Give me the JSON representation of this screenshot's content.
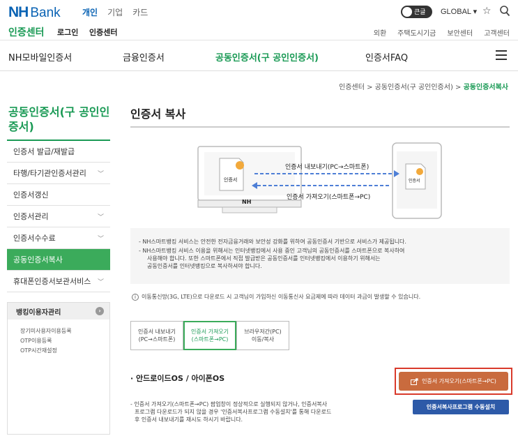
{
  "header": {
    "logo_nh": "NH",
    "logo_bank": "Bank",
    "nav": [
      "개인",
      "기업",
      "카드"
    ],
    "toggle_label": "큰글",
    "global_label": "GLOBAL ▾"
  },
  "certbar": {
    "title": "인증센터",
    "links": [
      "로그인",
      "인증센터"
    ],
    "utility": [
      "외환",
      "주택도시기금",
      "보안센터",
      "고객센터"
    ]
  },
  "mainnav": {
    "tabs": [
      "NH모바일인증서",
      "금융인증서",
      "공동인증서(구 공인인증서)",
      "인증서FAQ"
    ]
  },
  "breadcrumb": {
    "path": "인증센터 > 공동인증서(구 공인인증서) > ",
    "current": "공동인증서복사"
  },
  "sidebar": {
    "title": "공동인증서(구 공인인 증서)",
    "items": [
      {
        "label": "인증서 발급/재발급",
        "chevron": false
      },
      {
        "label": "타행/타기관인증서관리",
        "chevron": true
      },
      {
        "label": "인증서갱신",
        "chevron": false
      },
      {
        "label": "인증서관리",
        "chevron": true
      },
      {
        "label": "인증서수수료",
        "chevron": true
      },
      {
        "label": "공동인증서복사",
        "chevron": false
      },
      {
        "label": "휴대폰인증서보관서비스",
        "chevron": true
      }
    ],
    "box_title": "뱅킹이용자관리",
    "box_icon": "›",
    "box_links": [
      "장기미사용자이용등록",
      "OTP이용등록",
      "OTP시간재설정"
    ]
  },
  "content": {
    "title": "인증서 복사",
    "illus_export": "인증서 내보내기(PC→스마트폰)",
    "illus_import": "인증서 가져오기(스마트폰→PC)",
    "badge_pc": "인증서",
    "badge_phone": "인증서",
    "nh_mark": "NH",
    "notice": [
      "- NH스마트뱅킹 서비스는 안전한 전자금융거래와 보안성 강화를 위하여 공동인증서 기반으로 서비스가 제공됩니다.",
      "- NH스마트뱅킹 서비스 이용을 위해서는 인터넷뱅킹에서 사용 중인 고객님의 공동인증서를 스마트폰으로 복사하여",
      "사용해야 합니다. 또한 스마트폰에서 직접 발급받은 공동인증서를 인터넷뱅킹에서 이용하기 위해서는",
      "공동인증서를 인터넷뱅킹으로 복사하셔야 합니다."
    ],
    "info": "이동통신망(3G, LTE)으로 다운로드 시 고객님이 가입하신 이동통신사 요금제에 따라 데이터 과금이 발생할 수 있습니다.",
    "tabs": [
      {
        "line1": "인증서 내보내기",
        "line2": "(PC→스마트폰)"
      },
      {
        "line1": "인증서 가져오기",
        "line2": "(스마트폰→PC)"
      },
      {
        "line1": "브라우저간(PC)",
        "line2": "이동/복사"
      }
    ],
    "os_title": "· 안드로이드OS / 아이폰OS",
    "import_button": "인증서 가져오기(스마트폰→PC)",
    "install_button": "인증서복사프로그램 수동설치",
    "desc": [
      "- 인증서 가져오기(스마트폰→PC) 팝업창이 정상적으로 실행되지 않거나, 인증서복사",
      "프로그램 다운로드가 되지 않을 경우 '인증서복사프로그램 수동설치'를 통해 다운로드",
      "후 인증서 내보내기를 재시도 하시기 바랍니다."
    ]
  },
  "colors": {
    "brand_blue": "#0a63b4",
    "brand_green": "#1a9a55",
    "active_green": "#3bab5b",
    "highlight_red": "#d93a2b",
    "button_orange": "#c96b3e",
    "button_blue": "#2d5aa8"
  },
  "icons": [
    "star-icon",
    "search-icon",
    "hamburger-icon",
    "info-icon",
    "export-icon",
    "chevron-down-icon"
  ]
}
